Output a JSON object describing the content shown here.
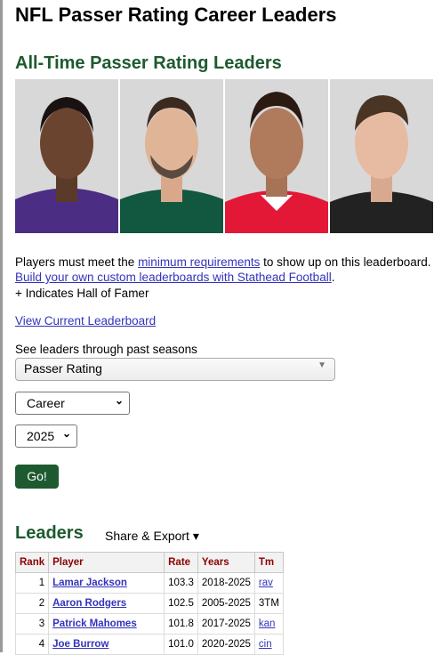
{
  "page": {
    "title": "NFL Passer Rating Career Leaders",
    "subtitle": "All-Time Passer Rating Leaders"
  },
  "headshots": [
    {
      "name": "Lamar Jackson",
      "jersey": "#4b2e83"
    },
    {
      "name": "Aaron Rodgers",
      "jersey": "#125740"
    },
    {
      "name": "Patrick Mahomes",
      "jersey": "#e31837"
    },
    {
      "name": "Joe Burrow",
      "jersey": "#222222"
    }
  ],
  "info": {
    "line1_prefix": "Players must meet the ",
    "line1_link": "minimum requirements",
    "line1_suffix": " to show up on this leaderboard.",
    "line2_link": "Build your own custom leaderboards with Stathead Football",
    "line2_suffix": ".",
    "line3": "+ Indicates Hall of Famer",
    "view_current": "View Current Leaderboard"
  },
  "filters": {
    "label": "See leaders through past seasons",
    "stat": "Passer Rating",
    "scope": "Career",
    "year": "2025",
    "go_label": "Go!"
  },
  "leaders": {
    "heading": "Leaders",
    "share_label": "Share & Export ▾",
    "columns": [
      "Rank",
      "Player",
      "Rate",
      "Years",
      "Tm"
    ],
    "rows": [
      {
        "rank": "1",
        "player": "Lamar Jackson",
        "rate": "103.3",
        "years": "2018-2025",
        "tm": "rav",
        "tm_link": true
      },
      {
        "rank": "2",
        "player": "Aaron Rodgers",
        "rate": "102.5",
        "years": "2005-2025",
        "tm": "3TM",
        "tm_link": false
      },
      {
        "rank": "3",
        "player": "Patrick Mahomes",
        "rate": "101.8",
        "years": "2017-2025",
        "tm": "kan",
        "tm_link": true
      },
      {
        "rank": "4",
        "player": "Joe Burrow",
        "rate": "101.0",
        "years": "2020-2025",
        "tm": "cin",
        "tm_link": true
      }
    ]
  }
}
